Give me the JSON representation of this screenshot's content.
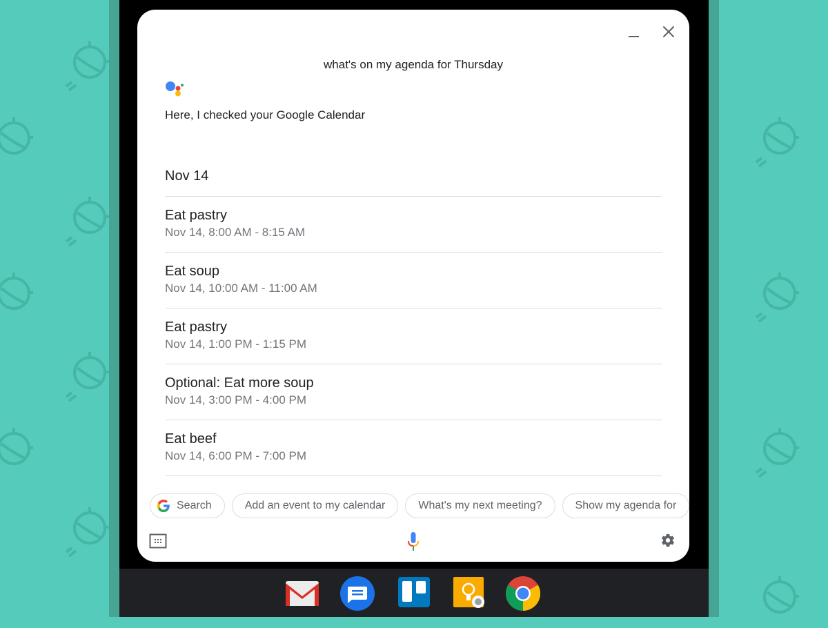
{
  "window": {
    "minimize_icon": "minimize-icon",
    "close_icon": "close-icon"
  },
  "assistant": {
    "query": "what's on my agenda for Thursday",
    "reply": "Here, I checked your Google Calendar",
    "date_header": "Nov 14",
    "events": [
      {
        "title": "Eat pastry",
        "time": "Nov 14, 8:00 AM - 8:15 AM"
      },
      {
        "title": "Eat soup",
        "time": "Nov 14, 10:00 AM - 11:00 AM"
      },
      {
        "title": "Eat pastry",
        "time": "Nov 14, 1:00 PM - 1:15 PM"
      },
      {
        "title": "Optional: Eat more soup",
        "time": "Nov 14, 3:00 PM - 4:00 PM"
      },
      {
        "title": "Eat beef",
        "time": "Nov 14, 6:00 PM - 7:00 PM"
      }
    ]
  },
  "suggestions": [
    {
      "label": "Search",
      "icon": "google-g-icon"
    },
    {
      "label": "Add an event to my calendar"
    },
    {
      "label": "What's my next meeting?"
    },
    {
      "label": "Show my agenda for"
    }
  ],
  "input_bar": {
    "keyboard_icon": "keyboard-icon",
    "mic_icon": "mic-icon",
    "settings_icon": "gear-icon"
  },
  "shelf": {
    "apps": [
      {
        "name": "Gmail",
        "icon": "gmail-icon"
      },
      {
        "name": "Messages",
        "icon": "messages-icon"
      },
      {
        "name": "Trello",
        "icon": "trello-icon"
      },
      {
        "name": "Keep",
        "icon": "keep-icon"
      },
      {
        "name": "Chrome",
        "icon": "chrome-icon"
      }
    ]
  },
  "colors": {
    "background": "#55cbbb",
    "google_blue": "#4285f4",
    "google_red": "#ea4335",
    "google_yellow": "#fbbc05",
    "google_green": "#34a853"
  }
}
